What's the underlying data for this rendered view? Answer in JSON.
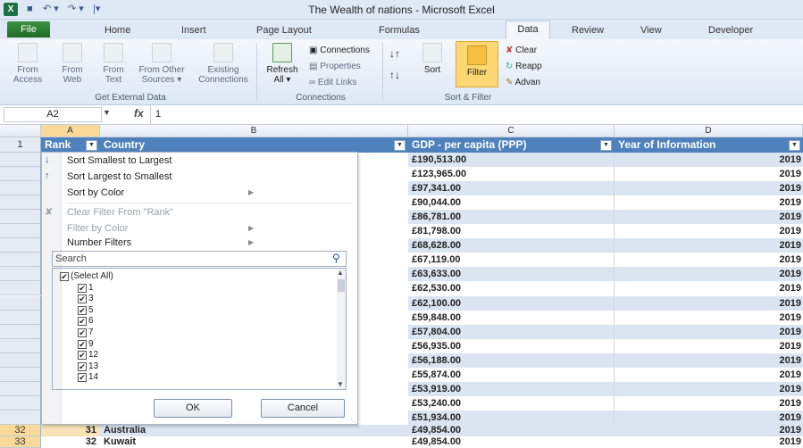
{
  "window": {
    "title": "The Wealth of nations  -  Microsoft Excel",
    "app_icon": "X"
  },
  "quick_access": [
    "■",
    "↶ ▾",
    "↷ ▾",
    "|▾"
  ],
  "tabs": {
    "file": "File",
    "items": [
      "Home",
      "Insert",
      "Page Layout",
      "Formulas",
      "Data",
      "Review",
      "View",
      "Developer"
    ],
    "active": "Data"
  },
  "ribbon": {
    "get_external": {
      "access": [
        "From",
        "Access"
      ],
      "web": [
        "From",
        "Web"
      ],
      "text": [
        "From",
        "Text"
      ],
      "other": [
        "From Other",
        "Sources ▾"
      ],
      "existing": [
        "Existing",
        "Connections"
      ],
      "label": "Get External Data"
    },
    "connections": {
      "refresh": [
        "Refresh",
        "All ▾"
      ],
      "items": [
        "Connections",
        "Properties",
        "Edit Links"
      ],
      "label": "Connections"
    },
    "sort_filter": {
      "sort": "Sort",
      "filter": "Filter",
      "side": [
        "Clear",
        "Reapp",
        "Advan"
      ],
      "label": "Sort & Filter"
    }
  },
  "formula_bar": {
    "name_box": "A2",
    "fx": "fx",
    "value": "1"
  },
  "columns": [
    "A",
    "B",
    "C",
    "D"
  ],
  "header_row": {
    "row": "1",
    "rank": "Rank",
    "country": "Country",
    "gdp": "GDP - per capita (PPP)",
    "year": "Year of Information"
  },
  "rows": [
    {
      "gdp": "£190,513.00",
      "year": "2019"
    },
    {
      "gdp": "£123,965.00",
      "year": "2019"
    },
    {
      "gdp": "£97,341.00",
      "year": "2019"
    },
    {
      "gdp": "£90,044.00",
      "year": "2019"
    },
    {
      "gdp": "£86,781.00",
      "year": "2019"
    },
    {
      "gdp": "£81,798.00",
      "year": "2019"
    },
    {
      "gdp": "£68,628.00",
      "year": "2019"
    },
    {
      "gdp": "£67,119.00",
      "year": "2019"
    },
    {
      "gdp": "£63,633.00",
      "year": "2019"
    },
    {
      "gdp": "£62,530.00",
      "year": "2019"
    },
    {
      "gdp": "£62,100.00",
      "year": "2019"
    },
    {
      "gdp": "£59,848.00",
      "year": "2019"
    },
    {
      "gdp": "£57,804.00",
      "year": "2019"
    },
    {
      "gdp": "£56,935.00",
      "year": "2019"
    },
    {
      "gdp": "£56,188.00",
      "year": "2019"
    },
    {
      "gdp": "£55,874.00",
      "year": "2019"
    },
    {
      "gdp": "£53,919.00",
      "year": "2019"
    },
    {
      "gdp": "£53,240.00",
      "year": "2019"
    },
    {
      "gdp": "£51,934.00",
      "year": "2019"
    }
  ],
  "bottom_rows": [
    {
      "row": "32",
      "rank": "31",
      "country": "Australia",
      "gdp": "£49,854.00",
      "year": "2019"
    },
    {
      "row": "33",
      "rank": "32",
      "country": "Kuwait",
      "gdp": "£49,854.00",
      "year": "2019"
    }
  ],
  "filter_menu": {
    "sort_asc": "Sort Smallest to Largest",
    "sort_desc": "Sort Largest to Smallest",
    "sort_color": "Sort by Color",
    "clear_filter": "Clear Filter From \"Rank\"",
    "filter_color": "Filter by Color",
    "number_filters": "Number Filters",
    "search_placeholder": "Search",
    "items": [
      "(Select All)",
      "1",
      "3",
      "5",
      "6",
      "7",
      "9",
      "12",
      "13",
      "14"
    ],
    "ok": "OK",
    "cancel": "Cancel"
  },
  "colors": {
    "header_blue": "#4f81bd",
    "band": "#dbe5f1",
    "file_green": "#2e7d32"
  }
}
